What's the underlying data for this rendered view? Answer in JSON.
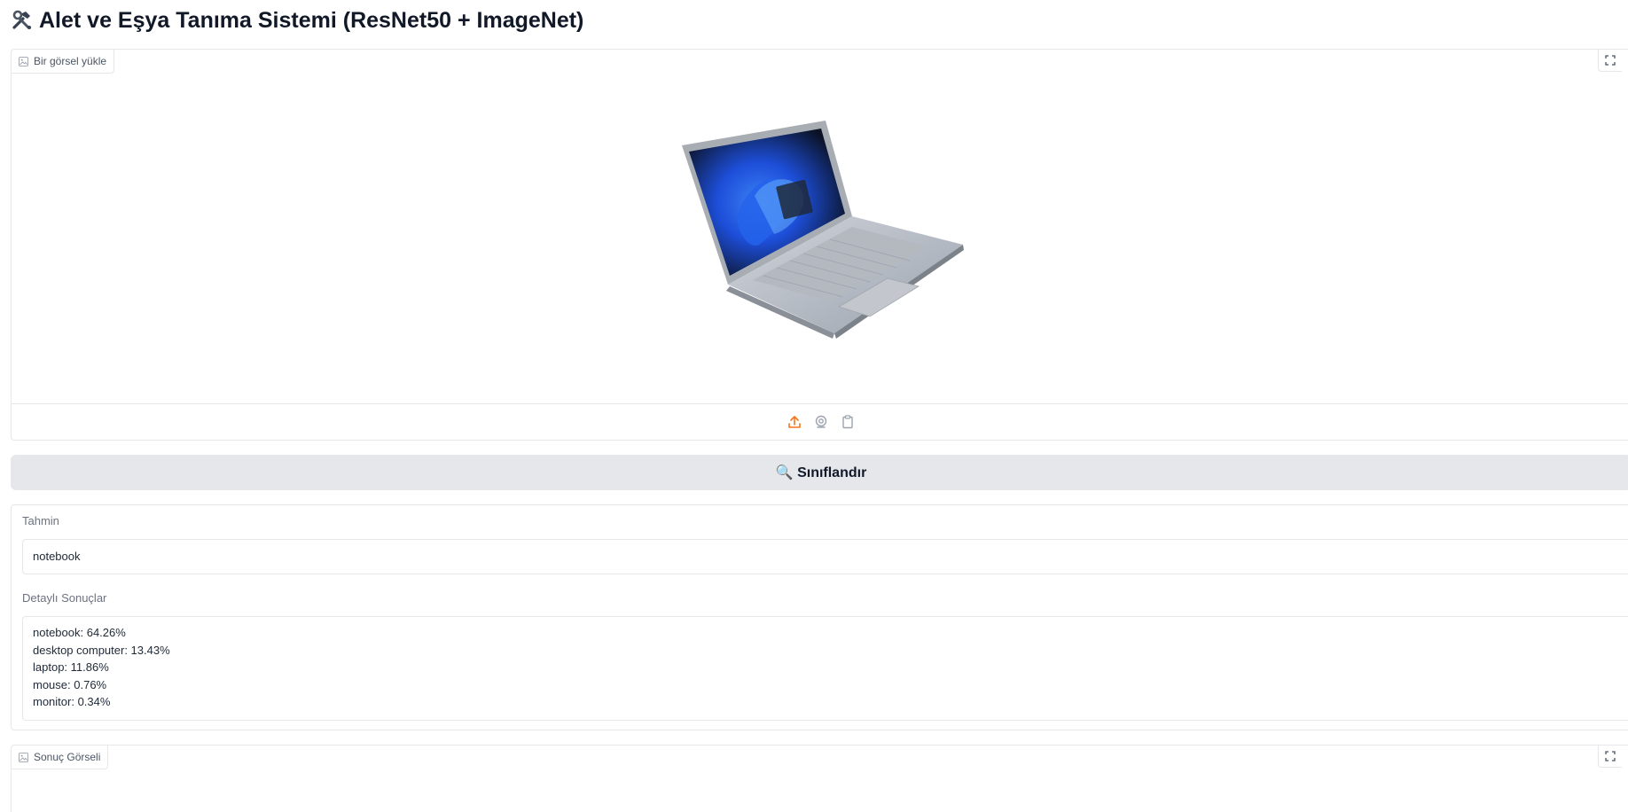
{
  "header": {
    "title": "Alet ve Eşya Tanıma Sistemi (ResNet50 + ImageNet)",
    "icon": "hammer-wrench-icon"
  },
  "upload": {
    "label": "Bir görsel yükle",
    "sources": [
      "upload-icon",
      "webcam-icon",
      "clipboard-icon"
    ],
    "accent": "#f97316"
  },
  "classify_button": {
    "label": "🔍 Sınıflandır"
  },
  "prediction": {
    "label": "Tahmin",
    "value": "notebook"
  },
  "details": {
    "label": "Detaylı Sonuçlar",
    "lines": [
      "notebook: 64.26%",
      "desktop computer: 13.43%",
      "laptop: 11.86%",
      "mouse: 0.76%",
      "monitor: 0.34%"
    ]
  },
  "result_image": {
    "label": "Sonuç Görseli"
  }
}
